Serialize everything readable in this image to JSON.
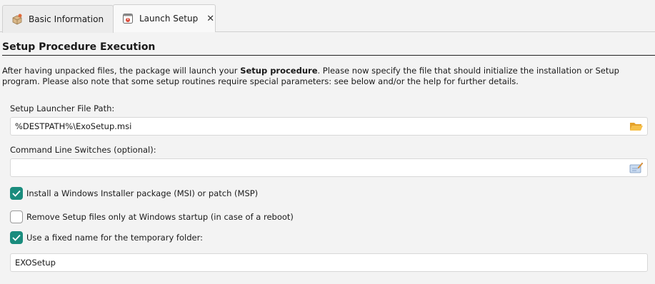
{
  "tabs": [
    {
      "label": "Basic Information",
      "icon": "box-icon",
      "active": false
    },
    {
      "label": "Launch Setup",
      "icon": "setup-icon",
      "active": true
    }
  ],
  "close_glyph": "✕",
  "section": {
    "title": "Setup Procedure Execution",
    "desc_before": "After having unpacked files, the package will launch your ",
    "desc_bold": "Setup procedure",
    "desc_after": ". Please now specify the file that should initialize the installation or Setup program. Please also note that some setup routines require special parameters: see below and/or the help for further details."
  },
  "launcher": {
    "label": "Setup Launcher File Path:",
    "value": "%DESTPATH%\\ExoSetup.msi",
    "icon": "folder-open-icon"
  },
  "switches": {
    "label": "Command Line Switches (optional):",
    "value": "",
    "icon": "edit-icon"
  },
  "options": [
    {
      "label": "Install a Windows Installer package (MSI) or patch (MSP)",
      "checked": true
    },
    {
      "label": "Remove Setup files only at Windows startup (in case of a reboot)",
      "checked": false
    },
    {
      "label": "Use a fixed name for the temporary folder:",
      "checked": true
    }
  ],
  "temp_folder": {
    "value": "EXOSetup"
  },
  "colors": {
    "accent": "#1a8c7d",
    "folder": "#f4b43a"
  }
}
